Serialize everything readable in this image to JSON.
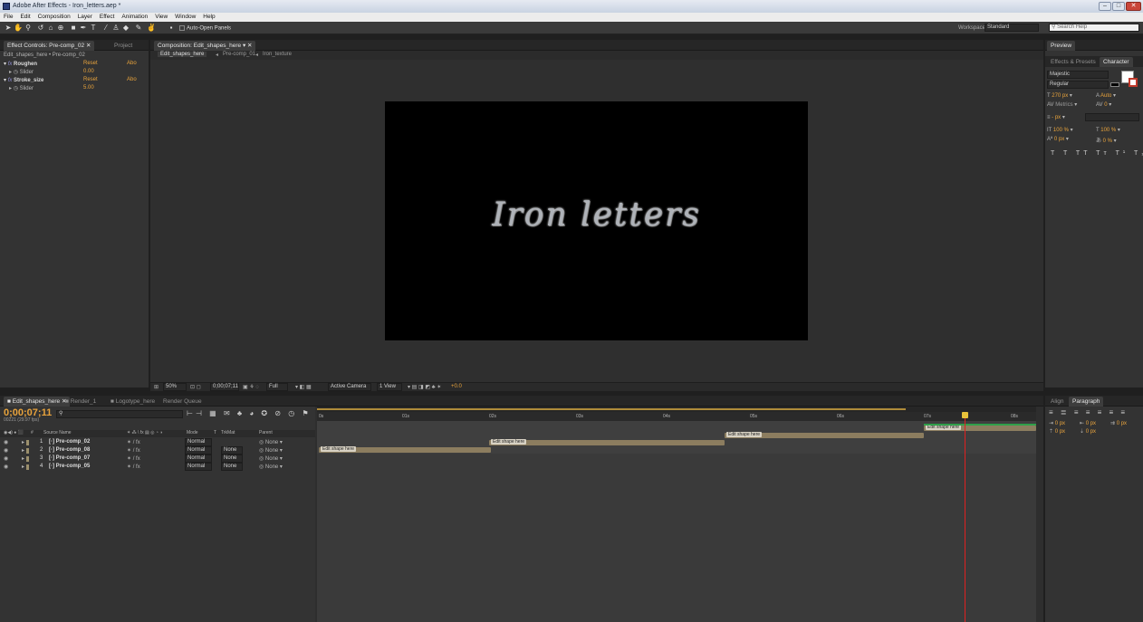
{
  "window": {
    "title": "Adobe After Effects - Iron_letters.aep *"
  },
  "menu": [
    "File",
    "Edit",
    "Composition",
    "Layer",
    "Effect",
    "Animation",
    "View",
    "Window",
    "Help"
  ],
  "toolbar": {
    "auto_open_panels": "Auto-Open Panels",
    "workspace_label": "Workspace:",
    "workspace_value": "Standard",
    "search_placeholder": "Search Help"
  },
  "effect_controls": {
    "tab_label": "Effect Controls: Pre-comp_02",
    "tab2_label": "Project",
    "breadcrumb": "Edit_shapes_here • Pre-comp_02",
    "effects": [
      {
        "name": "Roughen",
        "reset": "Reset",
        "about": "Abo",
        "slider_label": "Slider",
        "slider_value": "0.00"
      },
      {
        "name": "Stroke_size",
        "reset": "Reset",
        "about": "Abo",
        "slider_label": "Slider",
        "slider_value": "5.00"
      }
    ]
  },
  "composition": {
    "tab_label": "Composition: Edit_shapes_here",
    "subtabs": [
      "Edit_shapes_here",
      "Pre-comp_01",
      "Iron_texture"
    ],
    "canvas_text": "Iron letters",
    "bottom": {
      "zoom": "50%",
      "time": "0;00;07;11",
      "resolution": "Full",
      "camera": "Active Camera",
      "views": "1 View",
      "exposure": "+0.0"
    }
  },
  "right_panel": {
    "preview_tab": "Preview",
    "effects_presets_tab": "Effects & Presets",
    "character_tab": "Character",
    "font_name": "Majestic",
    "font_style": "Regular",
    "font_size": "270 px",
    "leading": "Auto",
    "kerning": "Metrics",
    "tracking": "0",
    "stroke_width": "- px",
    "vscale": "100 %",
    "hscale": "100 %",
    "baseline": "0 px",
    "tsume": "0 %"
  },
  "paragraph_panel": {
    "align_tab": "Align",
    "paragraph_tab": "Paragraph",
    "indent_left": "0 px",
    "indent_right": "0 px",
    "first_line": "0 px",
    "space_before": "0 px",
    "space_after": "0 px"
  },
  "timeline": {
    "tabs": [
      "Edit_shapes_here",
      "Render_1",
      "Logotype_here",
      "Render Queue"
    ],
    "current_time": "0;00;07;11",
    "fps": "00221 (29.97 fps)",
    "columns": [
      "#",
      "Source Name",
      "Mode",
      "T",
      "TrkMat",
      "Parent"
    ],
    "layers": [
      {
        "num": "1",
        "name": "Pre-comp_02",
        "mode": "Normal",
        "trkmat": "",
        "parent": "None",
        "bar_label": "Edit shape here"
      },
      {
        "num": "2",
        "name": "Pre-comp_08",
        "mode": "Normal",
        "trkmat": "None",
        "parent": "None",
        "bar_label": "Edit shape here"
      },
      {
        "num": "3",
        "name": "Pre-comp_07",
        "mode": "Normal",
        "trkmat": "None",
        "parent": "None",
        "bar_label": "Edit shape here"
      },
      {
        "num": "4",
        "name": "Pre-comp_05",
        "mode": "Normal",
        "trkmat": "None",
        "parent": "None",
        "bar_label": "Edit shape here"
      }
    ],
    "ruler": [
      "0s",
      "01s",
      "02s",
      "03s",
      "04s",
      "05s",
      "06s",
      "07s",
      "08s"
    ],
    "playhead_time_fraction": 0.9
  }
}
